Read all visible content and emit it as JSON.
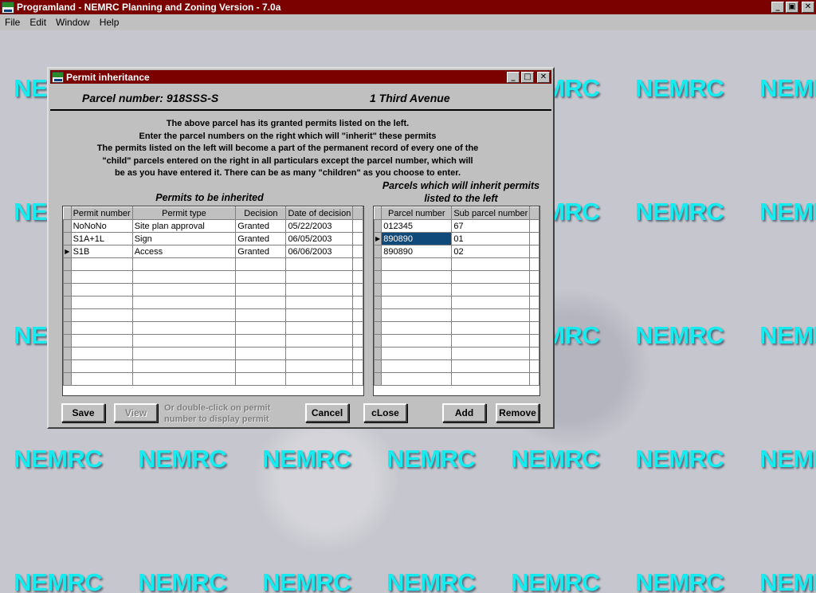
{
  "app": {
    "title": "Programland - NEMRC Planning and Zoning Version - 7.0a",
    "controls": {
      "minimize": "_",
      "maximize": "▣",
      "close": "✕"
    }
  },
  "menu": [
    {
      "label": "File"
    },
    {
      "label": "Edit"
    },
    {
      "label": "Window"
    },
    {
      "label": "Help"
    }
  ],
  "watermark": {
    "text": "NEMRC",
    "color": "#16ecf0"
  },
  "dialog": {
    "title": "Permit inheritance",
    "controls": {
      "minimize": "_",
      "maximize": "□",
      "close": "✕"
    },
    "parcel_label": "Parcel number:",
    "parcel_number": "918SSS-S",
    "address": "1 Third Avenue",
    "instructions": [
      "The above parcel has its granted permits listed on the left.",
      "Enter the parcel numbers on the right which will \"inherit\" these permits",
      "The permits listed on the left will become a part of the permanent record of every one of the",
      "\"child\" parcels entered on the right in all particulars except the parcel number, which will",
      "be as you have entered it.   There can be as many \"children\" as you choose to enter."
    ],
    "permits_label": "Permits to be inherited",
    "parcels_label_line1": "Parcels which will inherit permits",
    "parcels_label_line2": "listed to the left",
    "permits_columns": [
      "Permit number",
      "Permit type",
      "Decision",
      "Date of decision"
    ],
    "permits_rows": [
      [
        "NoNoNo",
        "Site plan approval",
        "Granted",
        "05/22/2003"
      ],
      [
        "S1A+1L",
        "Sign",
        "Granted",
        "06/05/2003"
      ],
      [
        "S1B",
        "Access",
        "Granted",
        "06/06/2003"
      ]
    ],
    "permits_current_row": 2,
    "parcels_columns": [
      "Parcel number",
      "Sub parcel number"
    ],
    "parcels_rows": [
      [
        "012345",
        "67"
      ],
      [
        "890890",
        "01"
      ],
      [
        "890890",
        "02"
      ]
    ],
    "parcels_current_row": 1,
    "buttons": {
      "save": "Save",
      "view": "View",
      "cancel": "Cancel",
      "close": "cLose",
      "add": "Add",
      "remove": "Remove"
    },
    "hint_line1": "Or double-click on permit",
    "hint_line2": "number to display permit",
    "row_marker": "▶"
  }
}
